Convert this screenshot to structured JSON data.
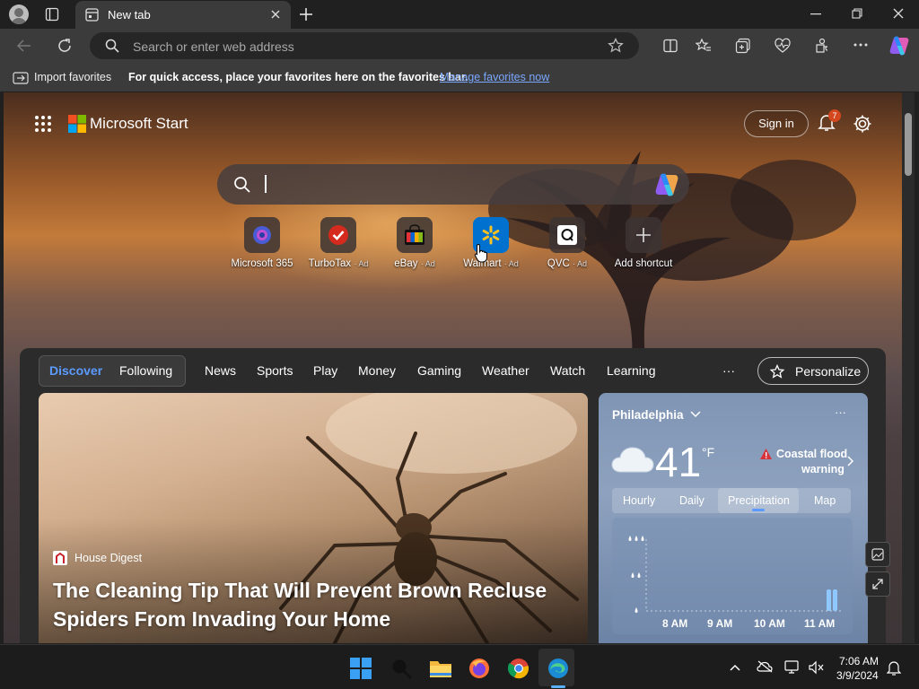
{
  "browser": {
    "tab_title": "New tab",
    "address_placeholder": "Search or enter web address"
  },
  "favorites_bar": {
    "import_label": "Import favorites",
    "hint": "For quick access, place your favorites here on the favorites bar.",
    "manage_link": "Manage favorites now"
  },
  "header": {
    "brand": "Microsoft Start",
    "sign_in": "Sign in",
    "notification_count": "7"
  },
  "quick_links": [
    {
      "name": "Microsoft 365",
      "ad": ""
    },
    {
      "name": "TurboTax",
      "ad": "· Ad"
    },
    {
      "name": "eBay",
      "ad": "· Ad"
    },
    {
      "name": "Walmart",
      "ad": "· Ad"
    },
    {
      "name": "QVC",
      "ad": "· Ad"
    },
    {
      "name": "Add shortcut",
      "ad": ""
    }
  ],
  "feed_nav": {
    "discover": "Discover",
    "following": "Following",
    "items": [
      "News",
      "Sports",
      "Play",
      "Money",
      "Gaming",
      "Weather",
      "Watch",
      "Learning"
    ],
    "more": "···",
    "personalize": "Personalize"
  },
  "article": {
    "source": "House Digest",
    "headline": "The Cleaning Tip That Will Prevent Brown Recluse Spiders From Invading Your Home"
  },
  "weather": {
    "city": "Philadelphia",
    "temperature": "41",
    "unit": "°F",
    "alert_line1": "Coastal flood",
    "alert_line2": "warning",
    "tabs": [
      "Hourly",
      "Daily",
      "Precipitation",
      "Map"
    ],
    "active_tab": "Precipitation",
    "times": [
      "8 AM",
      "9 AM",
      "10 AM",
      "11 AM"
    ],
    "more": "···"
  },
  "taskbar": {
    "time": "7:06 AM",
    "date": "3/9/2024"
  },
  "colors": {
    "accent": "#5b9bff",
    "notification_badge": "#d4481f",
    "link": "#7aa7ff"
  }
}
